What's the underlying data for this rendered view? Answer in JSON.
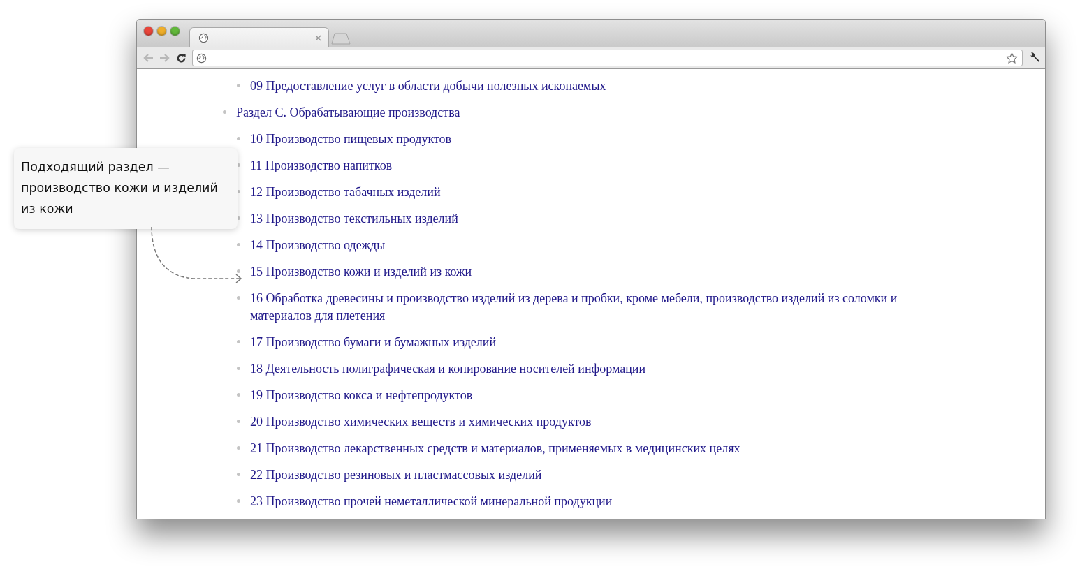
{
  "browser": {
    "tab": {
      "selected": true
    },
    "back_disabled": true,
    "forward_disabled": true
  },
  "outline": {
    "continued_items": [
      {
        "label": "09 Предоставление услуг в области добычи полезных ископаемых"
      }
    ],
    "sections": [
      {
        "label": "Раздел C. Обрабатывающие производства",
        "children": [
          {
            "label": "10 Производство пищевых продуктов"
          },
          {
            "label": "11 Производство напитков"
          },
          {
            "label": "12 Производство табачных изделий"
          },
          {
            "label": "13 Производство текстильных изделий"
          },
          {
            "label": "14 Производство одежды"
          },
          {
            "label": "15 Производство кожи и изделий из кожи"
          },
          {
            "label": "16 Обработка древесины и производство изделий из дерева и пробки, кроме мебели, производство изделий из соломки и материалов для плетения"
          },
          {
            "label": "17 Производство бумаги и бумажных изделий"
          },
          {
            "label": "18 Деятельность полиграфическая и копирование носителей информации"
          },
          {
            "label": "19 Производство кокса и нефтепродуктов"
          },
          {
            "label": "20 Производство химических веществ и химических продуктов"
          },
          {
            "label": "21 Производство лекарственных средств и материалов, применяемых в медицинских целях"
          },
          {
            "label": "22 Производство резиновых и пластмассовых изделий"
          },
          {
            "label": "23 Производство прочей неметаллической минеральной продукции"
          }
        ]
      }
    ]
  },
  "callout": {
    "text": "Подходящий раздел — производство кожи и изделий из кожи"
  }
}
